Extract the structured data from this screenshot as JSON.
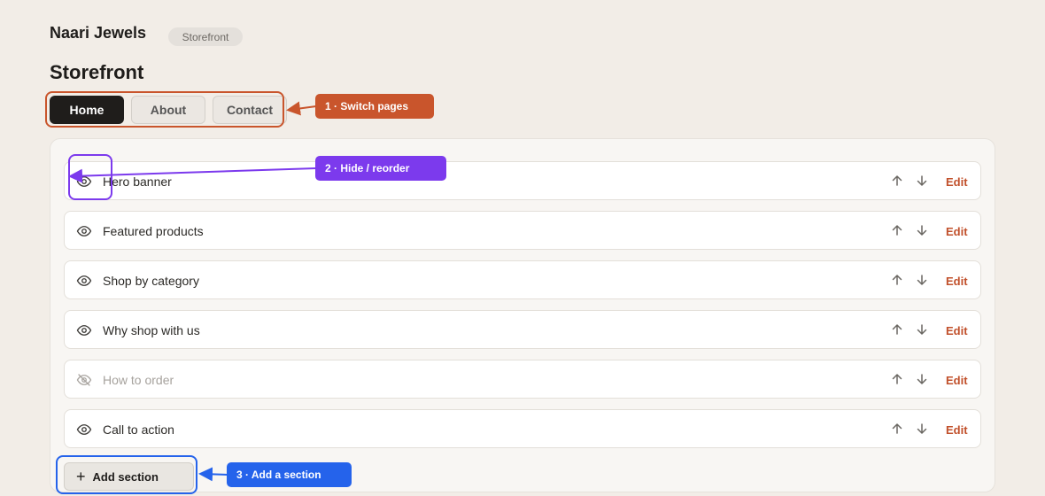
{
  "header": {
    "brand": "Naari Jewels",
    "breadcrumb_pill": "Storefront"
  },
  "page_title": "Storefront",
  "tabs": [
    {
      "label": "Home",
      "active": true
    },
    {
      "label": "About",
      "active": false
    },
    {
      "label": "Contact",
      "active": false
    }
  ],
  "sections": [
    {
      "label": "Hero banner",
      "visible": true,
      "edit_label": "Edit"
    },
    {
      "label": "Featured products",
      "visible": true,
      "edit_label": "Edit"
    },
    {
      "label": "Shop by category",
      "visible": true,
      "edit_label": "Edit"
    },
    {
      "label": "Why shop with us",
      "visible": true,
      "edit_label": "Edit"
    },
    {
      "label": "How to order",
      "visible": false,
      "edit_label": "Edit"
    },
    {
      "label": "Call to action",
      "visible": true,
      "edit_label": "Edit"
    }
  ],
  "add_section_label": "Add section",
  "callouts": [
    {
      "label": "1 · Switch pages",
      "color": "#c9552c"
    },
    {
      "label": "2 · Hide / reorder",
      "color": "#7c3aed"
    },
    {
      "label": "3 · Add a section",
      "color": "#2563eb"
    }
  ],
  "colors": {
    "accent": "#c1502b",
    "background": "#f2ede7",
    "active_tab": "#1f1d1b"
  }
}
